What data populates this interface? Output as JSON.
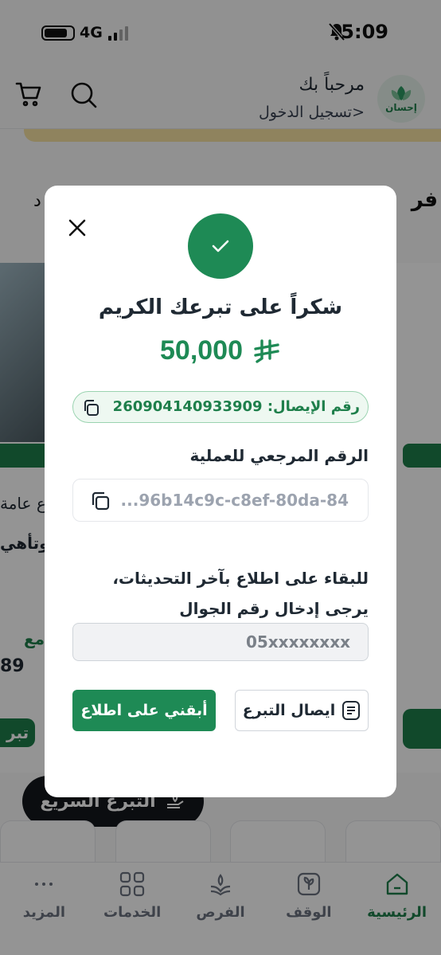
{
  "status_bar": {
    "time": "5:09",
    "network": "4G"
  },
  "header": {
    "greeting": "مرحباً بك",
    "login_link": "تسجيل الدخول>",
    "logo_text": "إحسان"
  },
  "background": {
    "section_title": "فر",
    "section_title_left": "د",
    "left_text_1": "ع عامة",
    "left_text_2": "وتأهي",
    "left_text_3": "مع",
    "left_amount": "89",
    "left_button": "تبر",
    "quick_donate_label": "التبرع السريع"
  },
  "bottom_nav": {
    "items": [
      {
        "label": "الرئيسية",
        "icon": "home-icon",
        "active": true
      },
      {
        "label": "الوقف",
        "icon": "waqf-icon",
        "active": false
      },
      {
        "label": "الفرص",
        "icon": "opportunities-icon",
        "active": false
      },
      {
        "label": "الخدمات",
        "icon": "services-grid-icon",
        "active": false
      },
      {
        "label": "المزيد",
        "icon": "more-dots-icon",
        "active": false
      }
    ]
  },
  "modal": {
    "title": "شكراً على تبرعك الكريم",
    "amount": "50,000",
    "receipt_label": "رقم الإيصال: 260904140933909",
    "ref_label": "الرقم المرجعي للعملية",
    "ref_value": "...96b14c9c-c8ef-80da-84",
    "update_text": "للبقاء على اطلاع بآخر التحديثات، يرجى إدخال رقم الجوال",
    "phone_placeholder": "05xxxxxxxx",
    "stay_button": "أبقني على اطلاع",
    "receipt_button": "ايصال التبرع"
  },
  "colors": {
    "brand_green": "#1e8a55",
    "overlay": "rgba(0,0,0,0.42)"
  }
}
